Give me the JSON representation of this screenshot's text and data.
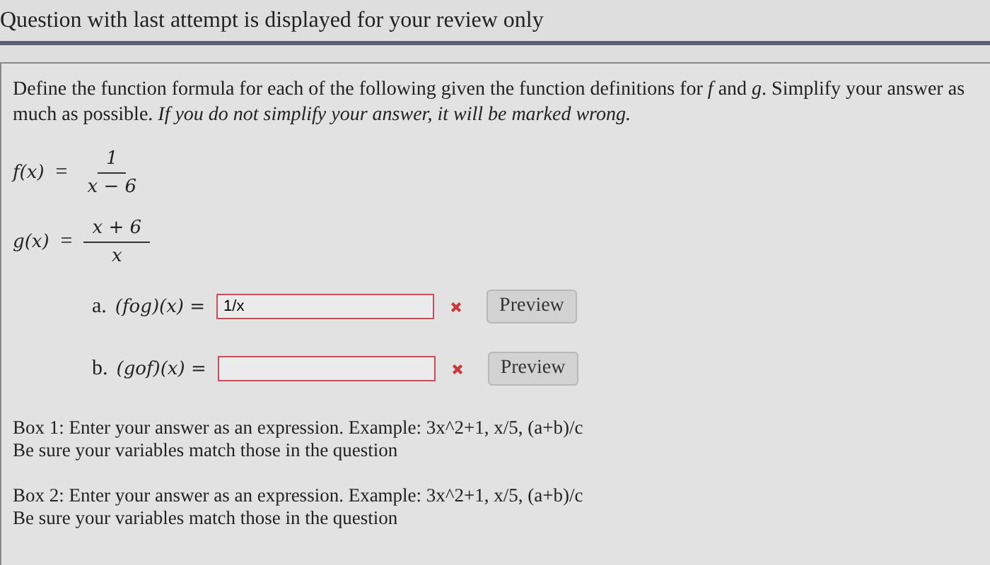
{
  "heading": "Question with last attempt is displayed for your review only",
  "problem": {
    "intro": "Define the function formula for each of the following given the function definitions for *f* and *g*. Simplify your answer as much as possible. *If you do not simplify your answer, it will be marked wrong.*",
    "definitions": [
      {
        "lhs": "f(x)",
        "eq": "=",
        "numerator": "1",
        "denominator": "x − 6"
      },
      {
        "lhs": "g(x)",
        "eq": "=",
        "numerator": "x + 6",
        "denominator": "x"
      }
    ],
    "answers": [
      {
        "label": "a.",
        "expression": "(fog)(x) =",
        "value": "1/x",
        "correct": false,
        "button": "Preview"
      },
      {
        "label": "b.",
        "expression": "(gof)(x) =",
        "correct": false,
        "button": "Preview"
      }
    ],
    "notes": [
      {
        "lines": [
          "Box 1: Enter your answer as an expression. Example: 3x^2+1, x/5, (a+b)/c",
          "Be sure your variables match those in the question"
        ]
      },
      {
        "lines": [
          "Box 2: Enter your answer as an expression. Example: 3x^2+1, x/5, (a+b)/c",
          "Be sure your variables match those in the question"
        ]
      }
    ]
  }
}
